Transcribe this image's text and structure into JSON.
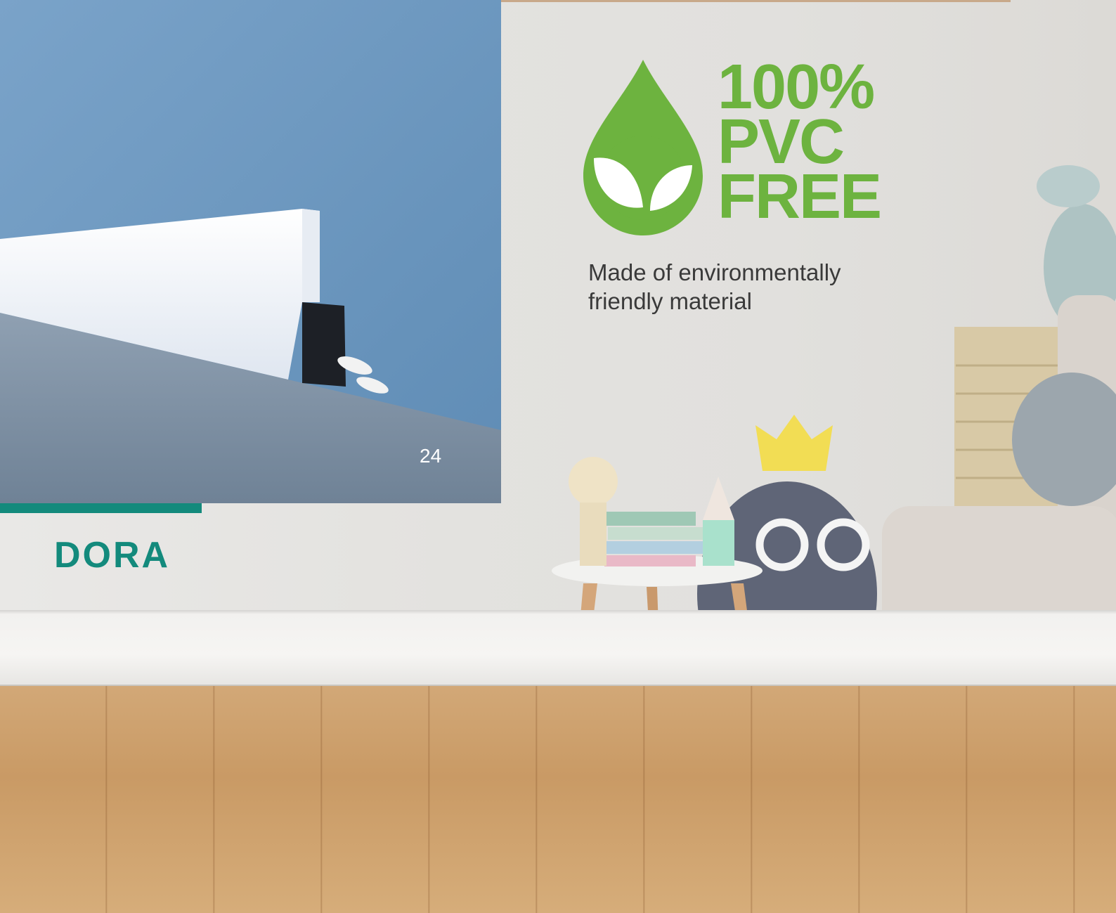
{
  "page": {
    "page_number": "24",
    "product_name": "DORA"
  },
  "badge": {
    "line1": "100%",
    "line2": "PVC",
    "line3": "FREE",
    "caption_line1": "Made of environmentally",
    "caption_line2": "friendly material",
    "icon": "leaf-drop-icon",
    "color": "#6db33f"
  },
  "colors": {
    "accent": "#138a7c",
    "badge_green": "#6db33f"
  }
}
